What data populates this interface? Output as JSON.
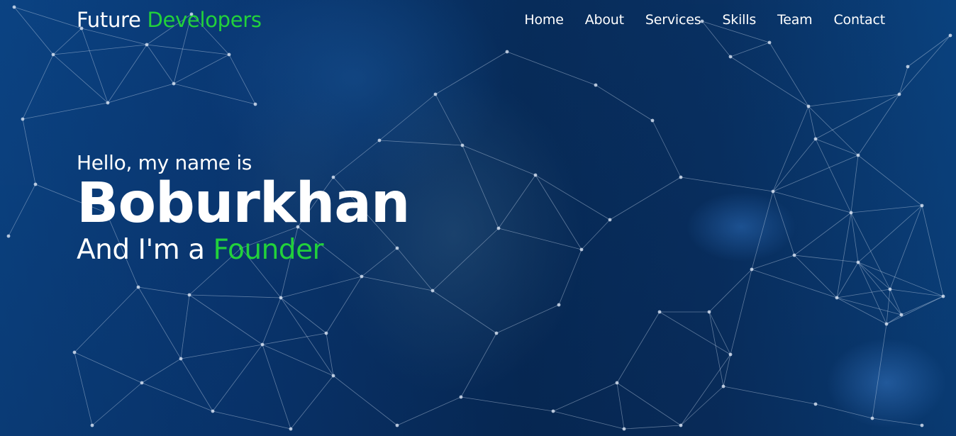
{
  "brand": {
    "part1": "Future",
    "part2": "Developers",
    "accent_color": "#22d13b"
  },
  "nav": {
    "items": [
      {
        "label": "Home"
      },
      {
        "label": "About"
      },
      {
        "label": "Services"
      },
      {
        "label": "Skills"
      },
      {
        "label": "Team"
      },
      {
        "label": "Contact"
      }
    ]
  },
  "hero": {
    "greeting": "Hello, my name is",
    "name": "Boburkhan",
    "tagline_prefix": "And I'm a",
    "role": "Founder"
  }
}
